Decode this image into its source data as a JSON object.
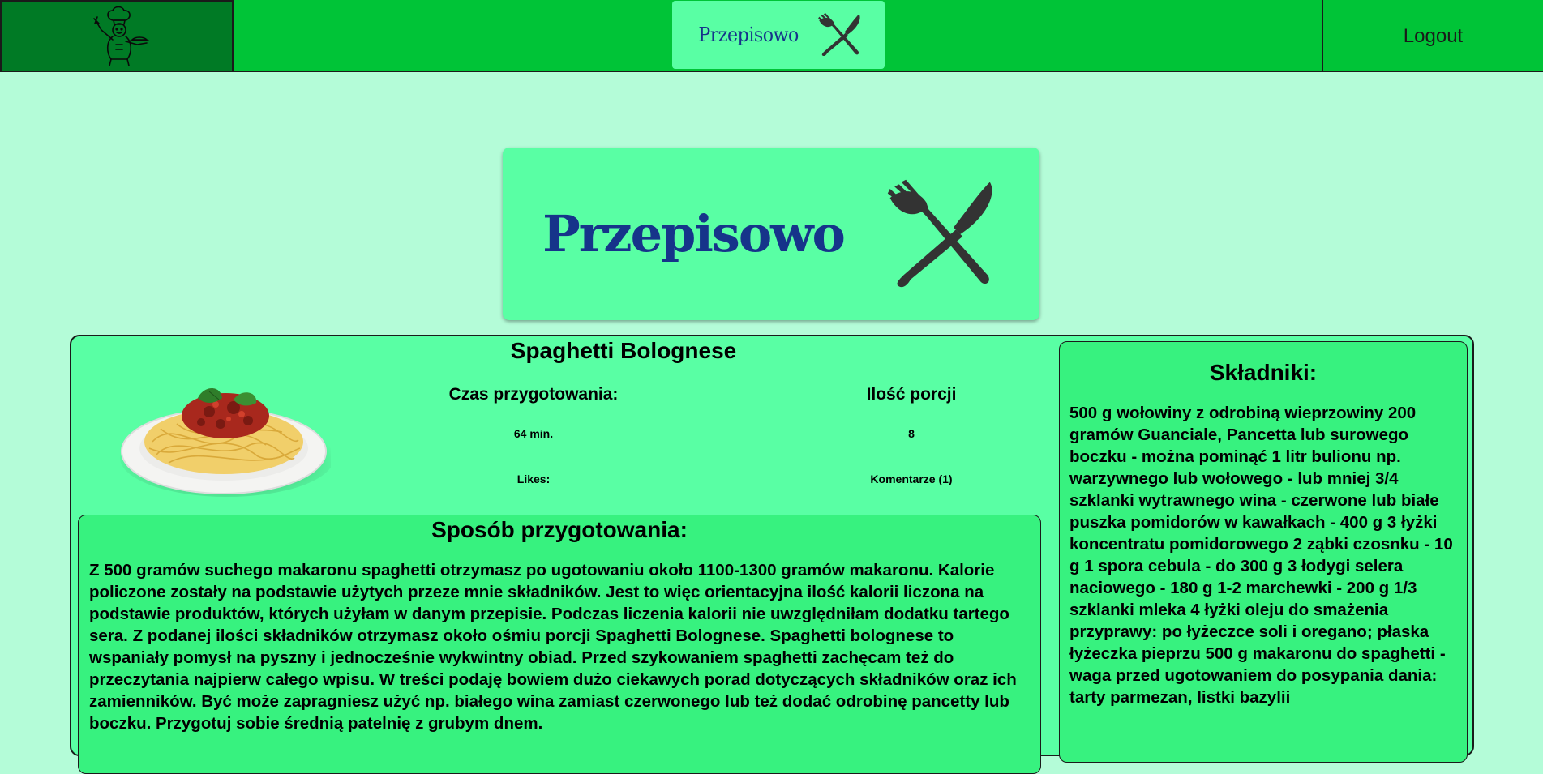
{
  "navbar": {
    "brand_small": "Przepisowo",
    "logout_label": "Logout"
  },
  "hero": {
    "brand_big": "Przepisowo"
  },
  "recipe": {
    "title": "Spaghetti Bolognese",
    "prep_time_label": "Czas przygotowania:",
    "prep_time_value": "64 min.",
    "servings_label": "Ilość porcji",
    "servings_value": "8",
    "likes_label": "Likes:",
    "comments_label": "Komentarze (1)",
    "method_heading": "Sposób przygotowania:",
    "method_text": "Z 500 gramów suchego makaronu spaghetti otrzymasz po ugotowaniu około 1100-1300 gramów makaronu. Kalorie policzone zostały na podstawie użytych przeze mnie składników. Jest to więc orientacyjna ilość kalorii liczona na podstawie produktów, których użyłam w danym przepisie. Podczas liczenia kalorii nie uwzględniłam dodatku tartego sera. Z podanej ilości składników otrzymasz około ośmiu porcji Spaghetti Bolognese. Spaghetti bolognese to wspaniały pomysł na pyszny i jednocześnie wykwintny obiad. Przed szykowaniem spaghetti zachęcam też do przeczytania najpierw całego wpisu. W treści podaję bowiem dużo ciekawych porad dotyczących składników oraz ich zamienników. Być może zapragniesz użyć np. białego wina zamiast czerwonego lub też dodać odrobinę pancetty lub boczku. Przygotuj sobie średnią patelnię z grubym dnem.",
    "ingredients_heading": "Składniki:",
    "ingredients_text": "500 g wołowiny z odrobiną wieprzowiny 200 gramów Guanciale, Pancetta lub surowego boczku - można pominąć 1 litr bulionu np. warzywnego lub wołowego - lub mniej 3/4 szklanki wytrawnego wina - czerwone lub białe puszka pomidorów w kawałkach - 400 g 3 łyżki koncentratu pomidorowego 2 ząbki czosnku - 10 g 1 spora cebula - do 300 g 3 łodygi selera naciowego - 180 g 1-2 marchewki - 200 g 1/3 szklanki mleka 4 łyżki oleju do smażenia przyprawy: po łyżeczce soli i oregano; płaska łyżeczka pieprzu 500 g makaronu do spaghetti - waga przed ugotowaniem do posypania dania: tarty parmezan, listki bazylii"
  },
  "colors": {
    "page_bg": "#b4fcd8",
    "navbar_bg": "#00c437",
    "navbar_left_bg": "#007a25",
    "logo_bg": "#59ffa4",
    "card_bg": "#59ffa4",
    "inner_box_bg": "#37f27f",
    "brand_text": "#16348a"
  },
  "icons": {
    "nav_left": "chef-icon",
    "nav_center": "fork-knife-icon",
    "hero": "fork-knife-icon",
    "dish": "spaghetti-plate-image"
  }
}
